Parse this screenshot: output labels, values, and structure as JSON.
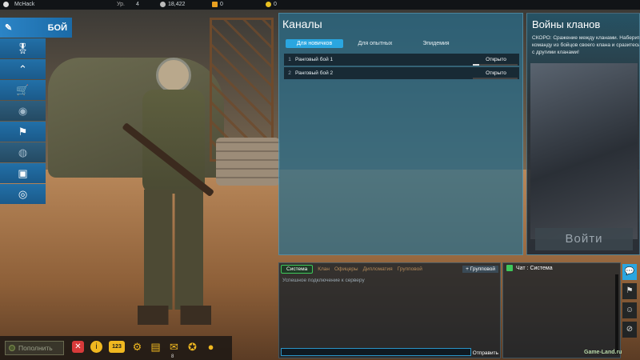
{
  "topbar": {
    "username": "McHack",
    "level_label": "Ур.",
    "level_value": "4",
    "currency1": "18,422",
    "currency2": "0",
    "currency3": "0"
  },
  "sidebar": {
    "active_label": "БОЙ",
    "items": [
      {
        "icon": "soldier-icon"
      },
      {
        "icon": "rank-chevron-icon"
      },
      {
        "icon": "cart-icon"
      },
      {
        "icon": "badge-icon"
      },
      {
        "icon": "flag-icon"
      },
      {
        "icon": "globe-icon"
      },
      {
        "icon": "id-card-icon"
      },
      {
        "icon": "target-icon"
      }
    ]
  },
  "channels": {
    "title": "Каналы",
    "tabs": [
      "Для новичков",
      "Для опытных",
      "Эпидемия"
    ],
    "rows": [
      {
        "num": "1",
        "name": "Ранговый бой 1",
        "status": "Открыто",
        "load": 0.15
      },
      {
        "num": "2",
        "name": "Ранговый бой 2",
        "status": "Открыто",
        "load": 0.0
      }
    ]
  },
  "clan": {
    "title": "Войны кланов",
    "text": "СКОРО: Сражение между кланами. Наберите команду из бойцов своего клана и сразитесь с другими кланами!",
    "button": "Войти"
  },
  "chat": {
    "tabs": [
      "Система",
      "Клан",
      "Офицеры",
      "Дипломатия",
      "Групповой"
    ],
    "group_tab": "Групповой",
    "message": "Успешное подключение к серверу",
    "send": "Отправить"
  },
  "syschat": {
    "title": "Чат : Система"
  },
  "bottom": {
    "topup": "Пополнить",
    "tag_text": "123",
    "mail_badge": "8"
  },
  "watermark": "Game-Land.ru"
}
